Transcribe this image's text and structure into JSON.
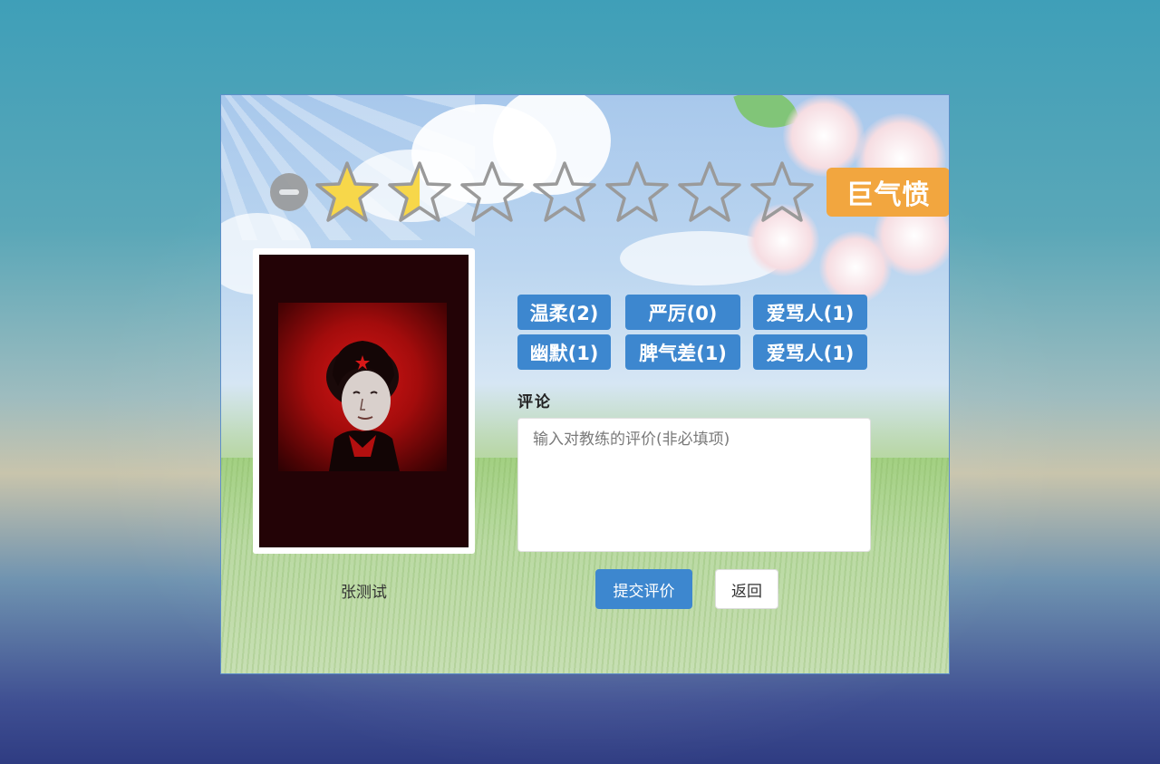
{
  "rating": {
    "value": 1.5,
    "max": 7,
    "minus_symbol": "−",
    "mood_label": "巨气愤",
    "star_fill_color": "#f7d74a",
    "star_empty_color": "#9a9a9a"
  },
  "coach": {
    "name": "张测试"
  },
  "tags": [
    {
      "label": "温柔(2)"
    },
    {
      "label": "严厉(0)"
    },
    {
      "label": "爱骂人(1)"
    },
    {
      "label": "幽默(1)"
    },
    {
      "label": "脾气差(1)"
    },
    {
      "label": "爱骂人(1)"
    }
  ],
  "comment": {
    "label": "评论",
    "placeholder": "输入对教练的评价(非必填项)",
    "value": ""
  },
  "actions": {
    "submit_label": "提交评价",
    "back_label": "返回"
  },
  "colors": {
    "primary": "#3d87cf",
    "mood_badge": "#f2a63f"
  }
}
